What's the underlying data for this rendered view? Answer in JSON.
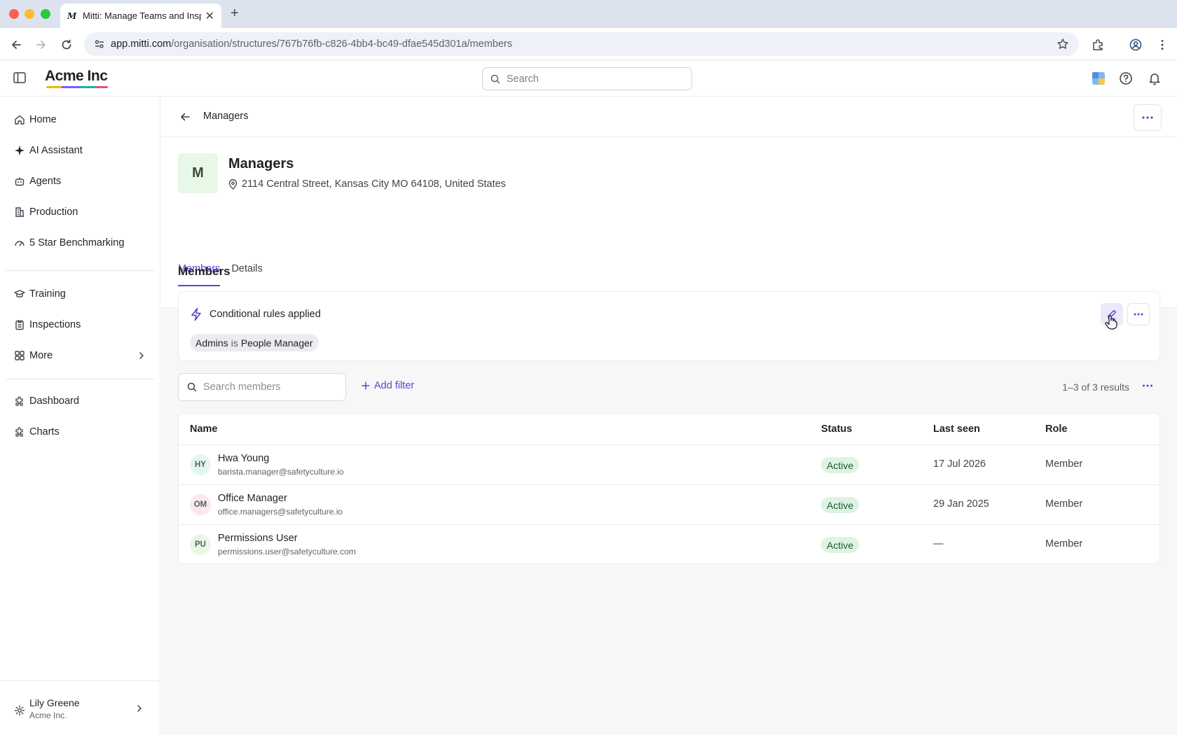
{
  "browser": {
    "tab_title": "Mitti: Manage Teams and Insp",
    "favicon_letter": "M",
    "url_host": "app.mitti.com",
    "url_path": "/organisation/structures/767b76fb-c826-4bb4-bc49-dfae545d301a/members"
  },
  "header": {
    "brand": "Acme Inc",
    "search_placeholder": "Search"
  },
  "sidebar": {
    "items": [
      {
        "label": "Home",
        "icon": "home-icon"
      },
      {
        "label": "AI Assistant",
        "icon": "sparkle-icon"
      },
      {
        "label": "Agents",
        "icon": "robot-icon"
      },
      {
        "label": "Production",
        "icon": "building-icon"
      },
      {
        "label": "5 Star Benchmarking",
        "icon": "gauge-icon"
      },
      {
        "label": "Training",
        "icon": "graduation-cap-icon"
      },
      {
        "label": "Inspections",
        "icon": "clipboard-icon"
      },
      {
        "label": "More",
        "icon": "grid-icon"
      },
      {
        "label": "Dashboard",
        "icon": "puzzle-icon"
      },
      {
        "label": "Charts",
        "icon": "puzzle-icon"
      }
    ],
    "user": {
      "name": "Lily Greene",
      "org": "Acme Inc."
    }
  },
  "page": {
    "breadcrumb": "Managers",
    "avatar_letter": "M",
    "title": "Managers",
    "address": "2114 Central Street, Kansas City MO 64108, United States",
    "tabs": [
      {
        "label": "Members",
        "active": true
      },
      {
        "label": "Details",
        "active": false
      }
    ],
    "section_title": "Members",
    "rules": {
      "title": "Conditional rules applied",
      "chip_field": "Admins",
      "chip_operator": "is",
      "chip_value": "People Manager"
    },
    "member_search_placeholder": "Search members",
    "add_filter": "Add filter",
    "results_text": "1–3 of 3 results"
  },
  "table": {
    "columns": [
      "Name",
      "Status",
      "Last seen",
      "Role"
    ],
    "rows": [
      {
        "initials": "HY",
        "name": "Hwa Young",
        "email": "barista.manager@safetyculture.io",
        "status": "Active",
        "last_seen": "17 Jul 2026",
        "role": "Member",
        "avatar_color": "#e3f6f2"
      },
      {
        "initials": "OM",
        "name": "Office Manager",
        "email": "office.managers@safetyculture.io",
        "status": "Active",
        "last_seen": "29 Jan 2025",
        "role": "Member",
        "avatar_color": "#fbe8ee"
      },
      {
        "initials": "PU",
        "name": "Permissions User",
        "email": "permissions.user@safetyculture.com",
        "status": "Active",
        "last_seen": "—",
        "role": "Member",
        "avatar_color": "#eaf7e6"
      }
    ]
  },
  "colors": {
    "accent": "#5b43d6",
    "status_active_bg": "#dff3e3",
    "status_active_text": "#1d5c2e"
  }
}
